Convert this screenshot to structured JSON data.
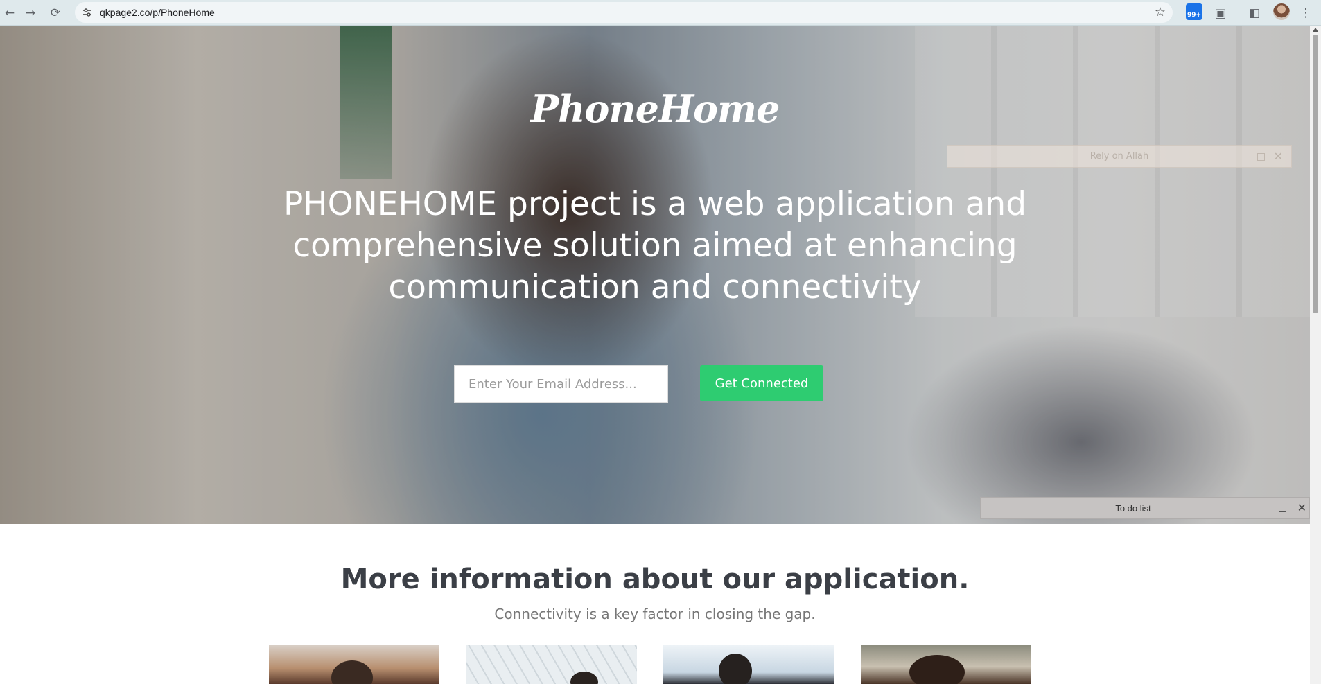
{
  "browser": {
    "url": "qkpage2.co/p/PhoneHome",
    "back_icon": "arrow-left-icon",
    "forward_icon": "arrow-right-icon",
    "reload_icon": "reload-icon",
    "extension_badge": "99+"
  },
  "hero": {
    "logo": "PhoneHome",
    "headline": "PHONEHOME project is a web application and comprehensive solution aimed at enhancing communication and connectivity",
    "email_placeholder": "Enter Your Email Address...",
    "cta_label": "Get Connected"
  },
  "overlays": {
    "note_label": "Rely on Allah",
    "todo_label": "To do list"
  },
  "info": {
    "title": "More information about our application.",
    "subtitle": "Connectivity is a key factor in closing the gap."
  },
  "colors": {
    "accent": "#2ecc71",
    "toolbar": "#dfe9ec"
  }
}
